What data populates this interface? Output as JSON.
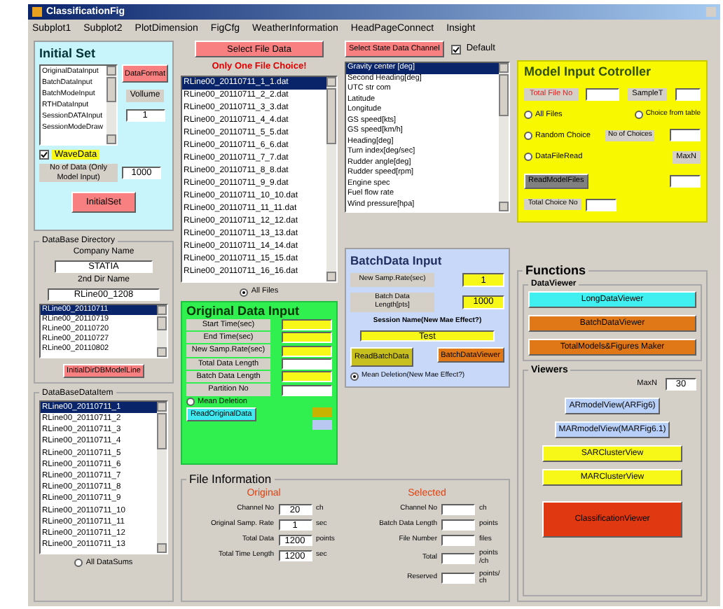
{
  "window": {
    "title": "ClassificationFig"
  },
  "menu": [
    "Subplot1",
    "Subplot2",
    "PlotDimension",
    "FigCfg",
    "WeatherInformation",
    "HeadPageConnect",
    "Insight"
  ],
  "initial_set": {
    "title": "Initial Set",
    "list": [
      {
        "label": "OriginalDataInput",
        "selected": false
      },
      {
        "label": "BatchDataInput",
        "selected": false
      },
      {
        "label": "BatchModeInput",
        "selected": false
      },
      {
        "label": "RTHDataInput",
        "selected": false
      },
      {
        "label": "SessionDATAInput",
        "selected": false
      },
      {
        "label": "SessionModeDraw",
        "selected": false
      }
    ],
    "format_button": "DataFormat",
    "volume_label": "Vollume",
    "volume_value": "1",
    "wave_data": {
      "label": "WaveData",
      "checked": true
    },
    "count_label": "No of Data (Only Model Input)",
    "count_value": "1000",
    "button": "InitialSet"
  },
  "database_directory": {
    "title": "DataBase Directory",
    "company_label": "Company Name",
    "company_value": "STATIA",
    "dir_label": "2nd Dir Name",
    "dir_value": "RLine00_1208",
    "list": [
      {
        "label": "RLine00_20110711",
        "selected": true
      },
      {
        "label": "RLine00_20110719",
        "selected": false
      },
      {
        "label": "RLine00_20110720",
        "selected": false
      },
      {
        "label": "RLine00_20110727",
        "selected": false
      },
      {
        "label": "RLine00_20110802",
        "selected": false
      }
    ],
    "button": "InitialDirDBModelLine"
  },
  "database_items": {
    "title": "DataBaseDataItem",
    "list": [
      {
        "label": "RLine00_20110711_1",
        "selected": true
      },
      {
        "label": "RLine00_20110711_2",
        "selected": false
      },
      {
        "label": "RLine00_20110711_3",
        "selected": false
      },
      {
        "label": "RLine00_20110711_4",
        "selected": false
      },
      {
        "label": "RLine00_20110711_5",
        "selected": false
      },
      {
        "label": "RLine00_20110711_6",
        "selected": false
      },
      {
        "label": "RLine00_20110711_7",
        "selected": false
      },
      {
        "label": "RLine00_20110711_8",
        "selected": false
      },
      {
        "label": "RLine00_20110711_9",
        "selected": false
      },
      {
        "label": "RLine00_20110711_10",
        "selected": false
      },
      {
        "label": "RLine00_20110711_11",
        "selected": false
      },
      {
        "label": "RLine00_20110711_12",
        "selected": false
      },
      {
        "label": "RLine00_20110711_13",
        "selected": false
      }
    ],
    "all_option": {
      "label": "All DataSums",
      "selected": false
    }
  },
  "file_select": {
    "button": "Select File Data",
    "note": "Only One File Choice!",
    "list": [
      {
        "label": "RLine00_20110711_1_1.dat",
        "selected": true
      },
      {
        "label": "RLine00_20110711_2_2.dat",
        "selected": false
      },
      {
        "label": "RLine00_20110711_3_3.dat",
        "selected": false
      },
      {
        "label": "RLine00_20110711_4_4.dat",
        "selected": false
      },
      {
        "label": "RLine00_20110711_5_5.dat",
        "selected": false
      },
      {
        "label": "RLine00_20110711_6_6.dat",
        "selected": false
      },
      {
        "label": "RLine00_20110711_7_7.dat",
        "selected": false
      },
      {
        "label": "RLine00_20110711_8_8.dat",
        "selected": false
      },
      {
        "label": "RLine00_20110711_9_9.dat",
        "selected": false
      },
      {
        "label": "RLine00_20110711_10_10.dat",
        "selected": false
      },
      {
        "label": "RLine00_20110711_11_11.dat",
        "selected": false
      },
      {
        "label": "RLine00_20110711_12_12.dat",
        "selected": false
      },
      {
        "label": "RLine00_20110711_13_13.dat",
        "selected": false
      },
      {
        "label": "RLine00_20110711_14_14.dat",
        "selected": false
      },
      {
        "label": "RLine00_20110711_15_15.dat",
        "selected": false
      },
      {
        "label": "RLine00_20110711_16_16.dat",
        "selected": false
      }
    ],
    "all_option": {
      "label": "All Files",
      "selected": true
    }
  },
  "original_data_input": {
    "title": "Original Data Input",
    "fields": [
      {
        "label": "Start Time(sec)",
        "highlight": true
      },
      {
        "label": "End Time(sec)",
        "highlight": true
      },
      {
        "label": "New Samp.Rate(sec)",
        "highlight": true
      },
      {
        "label": "Total Data Length",
        "highlight": false
      },
      {
        "label": "Batch Data Length",
        "highlight": true
      },
      {
        "label": "Partition No",
        "highlight": false
      }
    ],
    "mean_deletion": {
      "label": "Mean Deletion",
      "selected": false
    },
    "button": "ReadOriginalData",
    "indicators": [
      {
        "color": "#c8b400"
      },
      {
        "color": "#b8c8f0"
      }
    ]
  },
  "channel_select": {
    "button": "Select State Data Channel",
    "default": {
      "label": "Default",
      "checked": true
    },
    "list": [
      {
        "label": "Gravity center [deg]",
        "selected": true
      },
      {
        "label": "Second Heading[deg]",
        "selected": false
      },
      {
        "label": "UTC str com",
        "selected": false
      },
      {
        "label": "Latitude",
        "selected": false
      },
      {
        "label": "Longitude",
        "selected": false
      },
      {
        "label": "GS speed[kts]",
        "selected": false
      },
      {
        "label": "GS speed[km/h]",
        "selected": false
      },
      {
        "label": "Heading[deg]",
        "selected": false
      },
      {
        "label": "Turn index[deg/sec]",
        "selected": false
      },
      {
        "label": "Rudder angle[deg]",
        "selected": false
      },
      {
        "label": "Rudder speed[rpm]",
        "selected": false
      },
      {
        "label": "Engine spec",
        "selected": false
      },
      {
        "label": "Fuel flow rate",
        "selected": false
      },
      {
        "label": "Wind pressure[hpa]",
        "selected": false
      }
    ]
  },
  "batch_data_input": {
    "title": "BatchData Input",
    "samp_label": "New Samp.Rate(sec)",
    "samp_value": "1",
    "length_label": "Batch Data Length[pts]",
    "length_value": "1000",
    "session_label": "Session Name(New Mae Effect?)",
    "session_value": "Test",
    "read_button": "ReadBatchData",
    "viewer_button": "BatchDataViewer",
    "mean_deletion": {
      "label": "Mean Deletion(New Mae Effect?)",
      "selected": true
    }
  },
  "model_input_controller": {
    "title": "Model Input Cotroller",
    "total_label": "Total File No",
    "sample_label": "SampleT",
    "options": [
      {
        "label": "All Files",
        "selected": false
      },
      {
        "label": "Choice from table",
        "selected": false
      },
      {
        "label": "Random Choice",
        "selected": false
      },
      {
        "label": "DataFileRead",
        "selected": false
      }
    ],
    "choices_label": "No of Choices",
    "button": "ReadModelFiles",
    "maxn_label": "MaxN",
    "total_choice_label": "Total Choice No"
  },
  "functions": {
    "title": "Functions",
    "data_viewer": {
      "title": "DataViewer",
      "buttons": [
        {
          "label": "LongDataViewer",
          "color": "#40f0f0"
        },
        {
          "label": "BatchDataViewer",
          "color": "#e07818"
        },
        {
          "label": "TotalModels&Figures Maker",
          "color": "#e07818"
        }
      ]
    },
    "viewers": {
      "title": "Viewers",
      "maxn_label": "MaxN",
      "maxn_value": "30",
      "buttons": [
        {
          "label": "ARmodelView(ARFig6)",
          "color": "#b8d0f8"
        },
        {
          "label": "MARmodelView(MARFig6.1)",
          "color": "#b8d0f8"
        },
        {
          "label": "SARClusterView",
          "color": "#f8f818"
        },
        {
          "label": "MARClusterView",
          "color": "#f8f818"
        },
        {
          "label": "ClassificationViewer",
          "color": "#e03810"
        }
      ]
    }
  },
  "file_information": {
    "title": "File Information",
    "original": {
      "title": "Original",
      "rows": [
        {
          "label": "Channel No",
          "value": "20",
          "unit": "ch"
        },
        {
          "label": "Original Samp. Rate",
          "value": "1",
          "unit": "sec"
        },
        {
          "label": "Total Data",
          "value": "1200",
          "unit": "points"
        },
        {
          "label": "Total Time Length",
          "value": "1200",
          "unit": "sec"
        }
      ]
    },
    "selected": {
      "title": "Selected",
      "rows": [
        {
          "label": "Channel No",
          "unit": "ch"
        },
        {
          "label": "Batch Data Length",
          "unit": "points"
        },
        {
          "label": "File Number",
          "unit": "files"
        },
        {
          "label": "Total",
          "unit": "points /ch"
        },
        {
          "label": "Reserved",
          "unit": "points/ ch"
        }
      ]
    }
  }
}
